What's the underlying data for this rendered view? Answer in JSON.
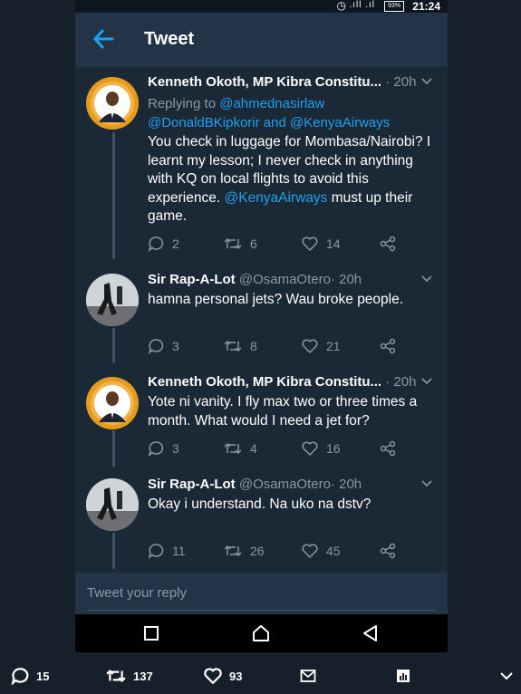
{
  "status_bar": {
    "battery": "93%",
    "time": "21:24"
  },
  "header": {
    "title": "Tweet"
  },
  "tweets": [
    {
      "name": "Kenneth Okoth, MP Kibra Constitu...",
      "handle": "",
      "time": "· 20h",
      "reply_prefix": "Replying to ",
      "reply_handles": [
        "@ahmednasirlaw",
        "@DonaldBKipkorir",
        " and ",
        "@KenyaAirways"
      ],
      "body_lines": [
        "You check in luggage for Mombasa/Nairobi? I",
        "learnt my lesson; I never check in anything",
        "with KQ on local flights to avoid this",
        "experience. ",
        "@KenyaAirways",
        " must up their",
        "game."
      ],
      "replies": "2",
      "retweets": "6",
      "likes": "14"
    },
    {
      "name": "Sir Rap-A-Lot",
      "handle": "@OsamaOtero",
      "time": "· 20h",
      "body_lines": [
        "hamna personal jets? Wau broke people."
      ],
      "replies": "3",
      "retweets": "8",
      "likes": "21"
    },
    {
      "name": "Kenneth Okoth, MP Kibra Constitu...",
      "handle": "",
      "time": "· 20h",
      "body_lines": [
        "Yote ni vanity. I fly max two or three times a",
        "month. What would I need a jet for?"
      ],
      "replies": "3",
      "retweets": "4",
      "likes": "16"
    },
    {
      "name": "Sir Rap-A-Lot",
      "handle": "@OsamaOtero",
      "time": "· 20h",
      "body_lines": [
        "Okay i understand. Na uko na dstv?"
      ],
      "replies": "11",
      "retweets": "26",
      "likes": "45"
    }
  ],
  "reply_box": {
    "placeholder": "Tweet your reply"
  },
  "bottom_actions": {
    "replies": "15",
    "retweets": "137",
    "likes": "93"
  },
  "colors": {
    "background": "#15202b",
    "card": "#1b2836",
    "bar": "#243447",
    "link": "#1da1f2",
    "muted": "#8899a6"
  }
}
